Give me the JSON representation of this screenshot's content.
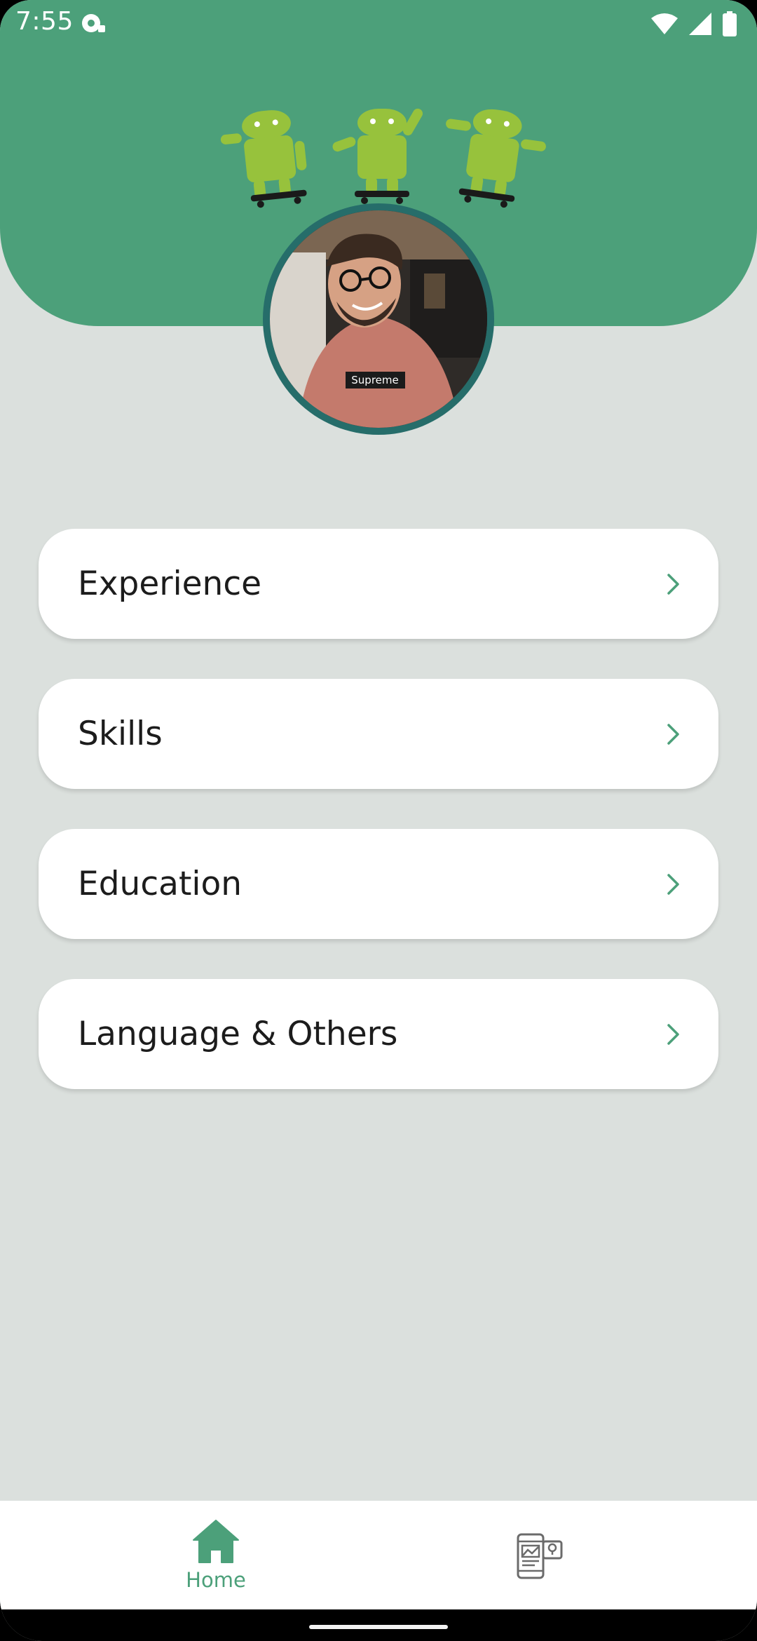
{
  "status_bar": {
    "time": "7:55",
    "icons": [
      "notification-icon",
      "wifi-icon",
      "signal-icon",
      "battery-icon"
    ]
  },
  "header": {
    "background_color": "#4ca07a",
    "mascot_image": "android-skateboard-icon",
    "avatar_image": "profile-photo"
  },
  "menu": {
    "items": [
      {
        "label": "Experience"
      },
      {
        "label": "Skills"
      },
      {
        "label": "Education"
      },
      {
        "label": "Language & Others"
      }
    ],
    "chevron_color": "#4ca07a"
  },
  "bottom_nav": {
    "items": [
      {
        "label": "Home",
        "icon": "home-icon",
        "active": true
      },
      {
        "label": "",
        "icon": "projects-icon",
        "active": false
      }
    ],
    "accent_color": "#4ca07a"
  }
}
